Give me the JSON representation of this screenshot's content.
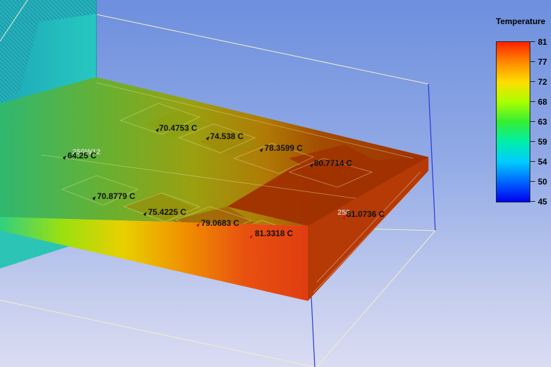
{
  "legend": {
    "title": "Temperature",
    "values": [
      "81",
      "77",
      "72",
      "68",
      "63",
      "59",
      "54",
      "50",
      "45"
    ]
  },
  "probes": [
    {
      "label": "70.4753 C"
    },
    {
      "label": "74.538 C"
    },
    {
      "label": "78.3599 C"
    },
    {
      "label": "80.7714 C"
    },
    {
      "label": "64.25 C"
    },
    {
      "label": "70.8779 C"
    },
    {
      "label": "75.4225 C"
    },
    {
      "label": "79.0683 C"
    },
    {
      "label": "81.3318 C"
    },
    {
      "label": "81.0736 C"
    }
  ],
  "ghost_labels": [
    "250W12",
    "250"
  ],
  "colors": {
    "hot": "#a03000",
    "warm": "#d07000",
    "mid": "#9ab000",
    "cool": "#40b060",
    "cold": "#20b0a0",
    "enclosure": "#f0f0c8",
    "edge": "#2222cc"
  }
}
